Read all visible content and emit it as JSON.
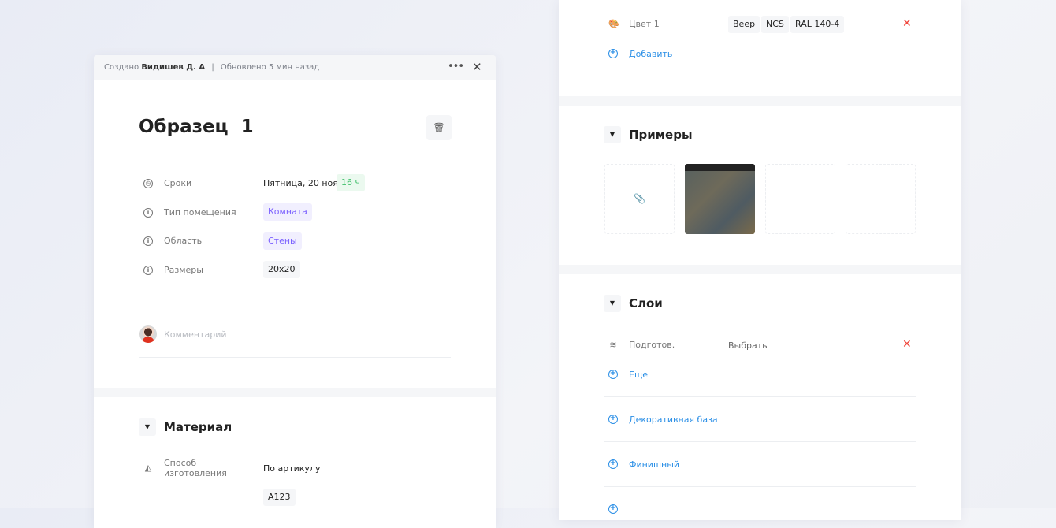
{
  "left": {
    "header": {
      "created_prefix": "Создано",
      "author": "Видишев Д. А",
      "separator": "|",
      "updated": "Обновлено 5 мин назад"
    },
    "title": "Образец  1",
    "fields": [
      {
        "label": "Сроки",
        "value": "Пятница, 20 ноя",
        "badge": "16 ч"
      },
      {
        "label": "Тип помещения",
        "value": "Комната"
      },
      {
        "label": "Область",
        "value": "Стены"
      },
      {
        "label": "Размеры",
        "value": "20x20"
      }
    ],
    "comment_placeholder": "Комментарий",
    "material": {
      "title": "Материал",
      "method_label": "Способ изготовления",
      "method_value": "По артикулу",
      "article": "A123"
    }
  },
  "right": {
    "color": {
      "label": "Цвет 1",
      "chips": [
        "Beep",
        "NCS",
        "RAL 140-4"
      ],
      "add": "Добавить"
    },
    "examples": {
      "title": "Примеры"
    },
    "layers": {
      "title": "Слои",
      "prep_label": "Подготов.",
      "prep_value": "Выбрать",
      "more": "Еще",
      "decor": "Декоративная база",
      "finish": "Финишный"
    }
  },
  "colors": {
    "accent": "#2b8fe6",
    "danger": "#f0463c",
    "success": "#3fbf6a",
    "purple": "#7b61ff"
  }
}
